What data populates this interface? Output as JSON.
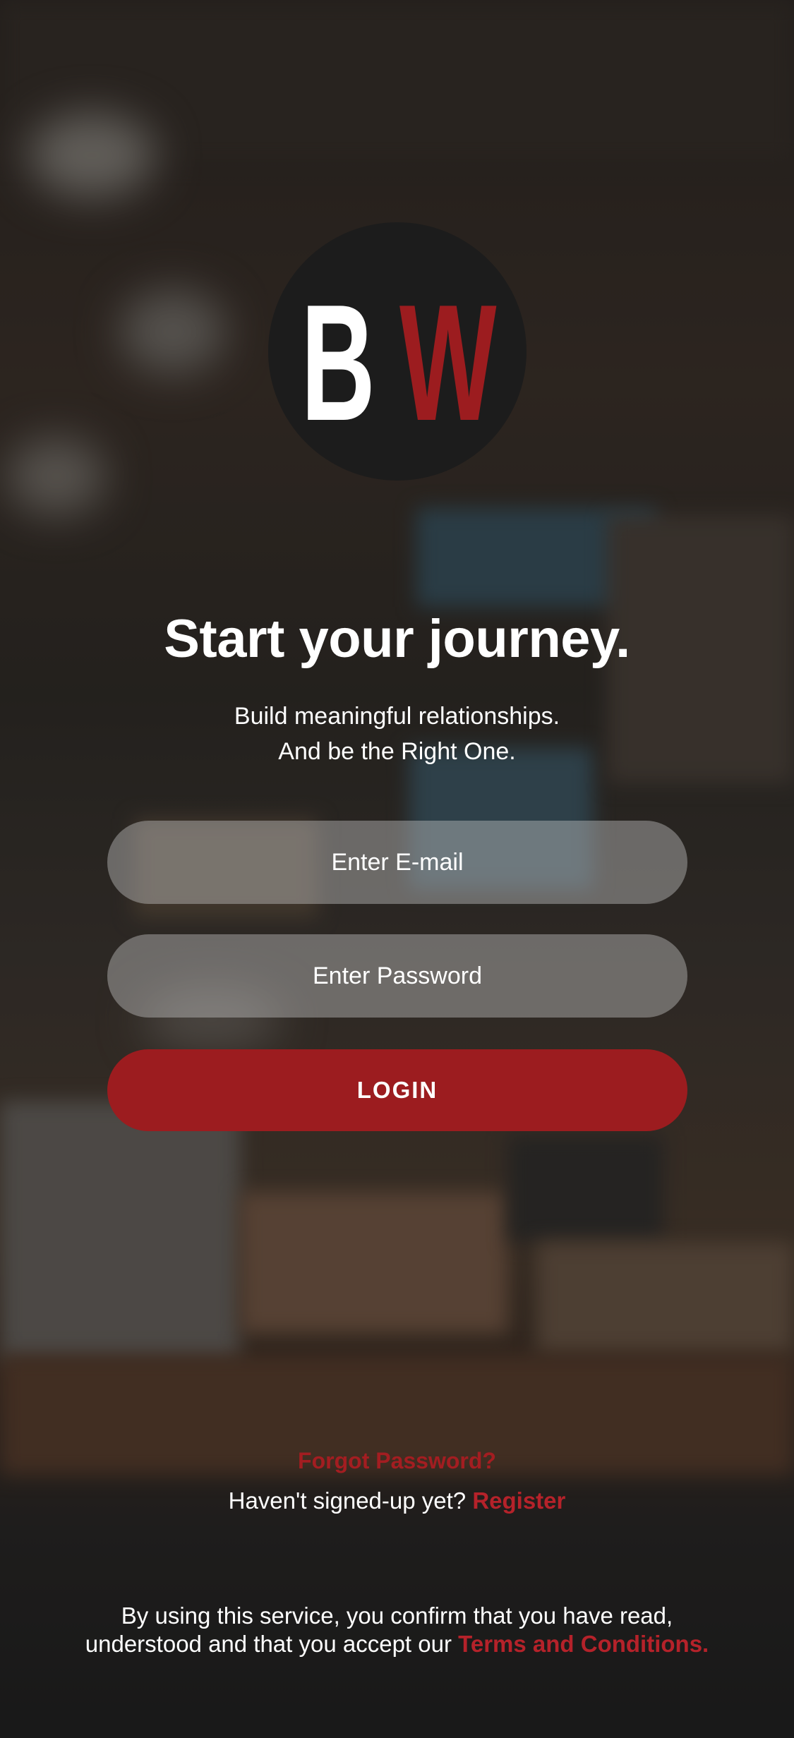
{
  "colors": {
    "accent": "#9c1c1f",
    "link": "#b5222a",
    "text": "#ffffff"
  },
  "logo": {
    "letter_left": "B",
    "letter_right": "W"
  },
  "hero": {
    "title": "Start your journey.",
    "subtitle_line1": "Build meaningful relationships.",
    "subtitle_line2": "And be the Right One."
  },
  "form": {
    "email_placeholder": "Enter E-mail",
    "password_placeholder": "Enter Password",
    "login_label": "LOGIN"
  },
  "links": {
    "forgot_password": "Forgot Password?",
    "signup_prompt": "Haven't signed-up yet?",
    "register": "Register"
  },
  "footer": {
    "terms_line1": "By using this service, you confirm that you have read,",
    "terms_line2_prefix": "understood and that you accept our",
    "terms_link": "Terms and Conditions."
  }
}
